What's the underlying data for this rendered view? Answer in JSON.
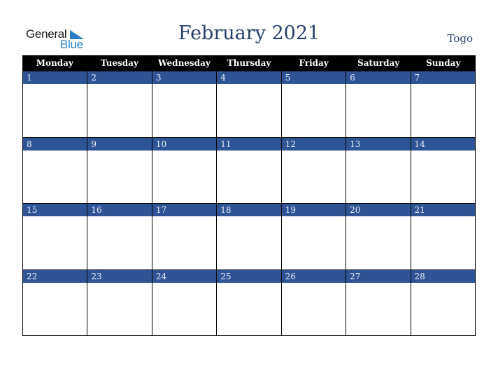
{
  "logo": {
    "word1": "General",
    "word2": "Blue",
    "icon": "triangle-flag-icon"
  },
  "header": {
    "title": "February 2021",
    "country": "Togo"
  },
  "calendar": {
    "days_of_week": [
      "Monday",
      "Tuesday",
      "Wednesday",
      "Thursday",
      "Friday",
      "Saturday",
      "Sunday"
    ],
    "weeks": [
      [
        "1",
        "2",
        "3",
        "4",
        "5",
        "6",
        "7"
      ],
      [
        "8",
        "9",
        "10",
        "11",
        "12",
        "13",
        "14"
      ],
      [
        "15",
        "16",
        "17",
        "18",
        "19",
        "20",
        "21"
      ],
      [
        "22",
        "23",
        "24",
        "25",
        "26",
        "27",
        "28"
      ]
    ]
  },
  "colors": {
    "header_bg": "#000000",
    "date_strip": "#2e5496",
    "title": "#253f6e",
    "logo_blue": "#2b7fc4"
  }
}
